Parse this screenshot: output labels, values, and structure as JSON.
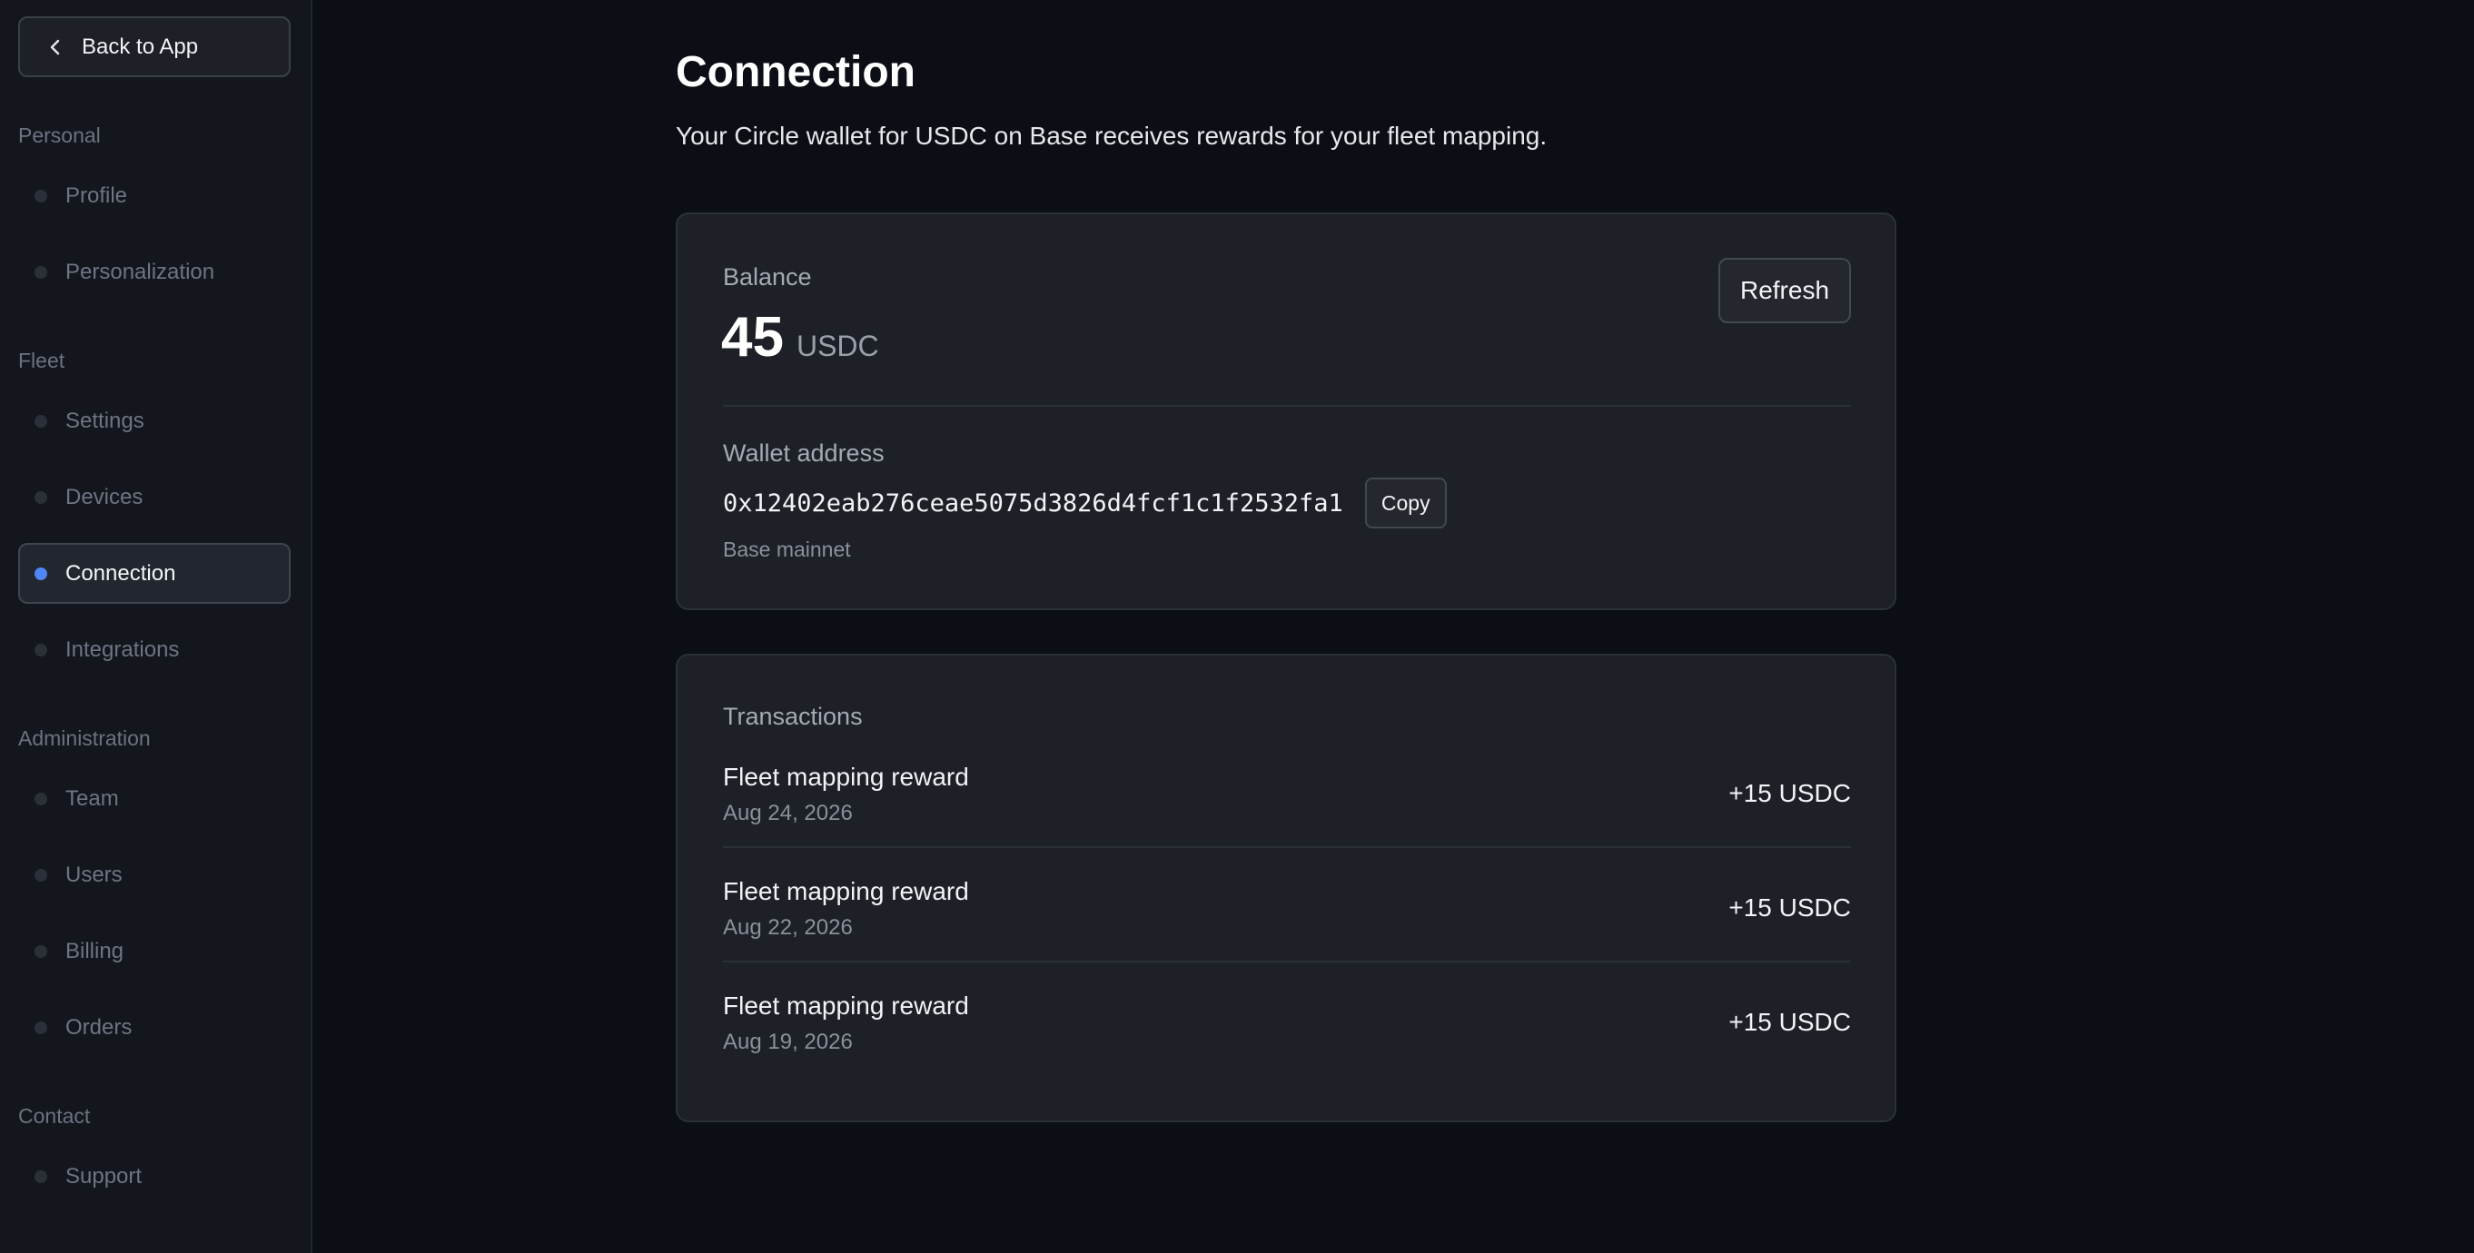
{
  "sidebar": {
    "back_label": "Back to App",
    "sections": {
      "personal": "Personal",
      "fleet": "Fleet",
      "administration": "Administration",
      "contact": "Contact"
    },
    "items": {
      "profile": "Profile",
      "personalization": "Personalization",
      "settings": "Settings",
      "devices": "Devices",
      "connection": "Connection",
      "integrations": "Integrations",
      "team": "Team",
      "users": "Users",
      "billing": "Billing",
      "orders": "Orders",
      "support": "Support"
    },
    "active_item": "connection"
  },
  "header": {
    "title": "Connection",
    "subtitle": "Your Circle wallet for USDC on Base receives rewards for your fleet mapping."
  },
  "balance_card": {
    "label": "Balance",
    "amount": "45",
    "unit": "USDC",
    "refresh_label": "Refresh",
    "wallet_label": "Wallet address",
    "wallet_address": "0x12402eab276ceae5075d3826d4fcf1c1f2532fa1",
    "copy_label": "Copy",
    "network": "Base mainnet"
  },
  "transactions": {
    "title": "Transactions",
    "rows": [
      {
        "description": "Fleet mapping reward",
        "date": "Aug 24, 2026",
        "amount": "+15 USDC"
      },
      {
        "description": "Fleet mapping reward",
        "date": "Aug 22, 2026",
        "amount": "+15 USDC"
      },
      {
        "description": "Fleet mapping reward",
        "date": "Aug 19, 2026",
        "amount": "+15 USDC"
      }
    ]
  },
  "colors": {
    "background": "#0b0e14",
    "sidebar": "#13161d",
    "card": "#1d2027",
    "accent": "#4f86f7"
  },
  "icons": {
    "back": "chevron-left-icon",
    "nav_bullet": "dot-icon"
  }
}
